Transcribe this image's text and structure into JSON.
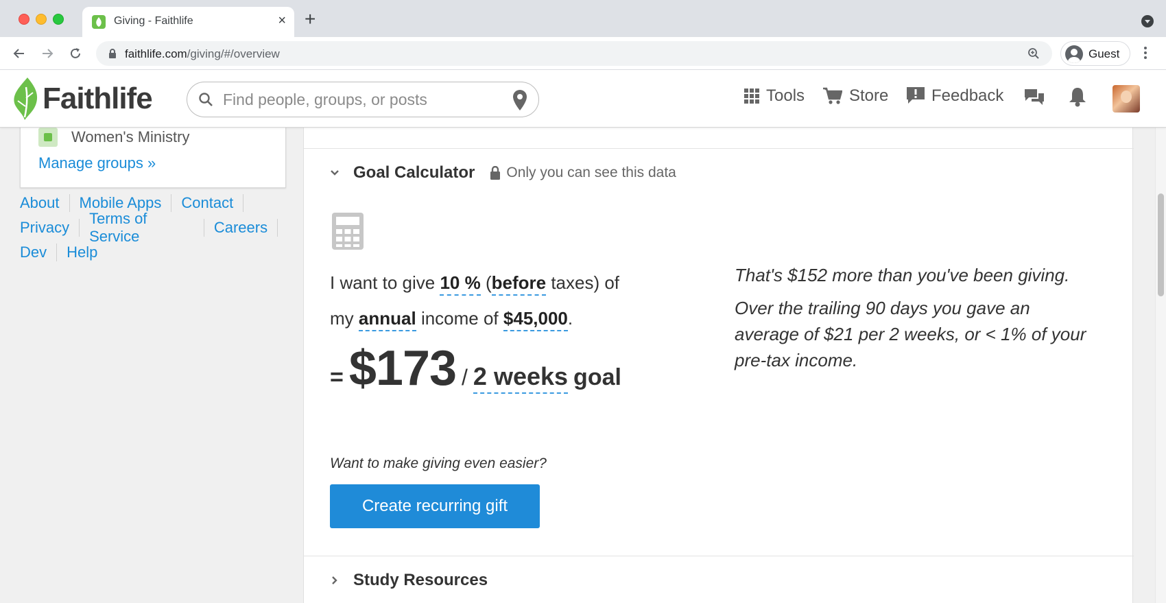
{
  "browser": {
    "tab_title": "Giving - Faithlife",
    "url_domain": "faithlife.com",
    "url_path": "/giving/#/overview",
    "profile_name": "Guest"
  },
  "header": {
    "logo_text": "Faithlife",
    "search_placeholder": "Find people, groups, or posts",
    "nav": {
      "tools": "Tools",
      "store": "Store",
      "feedback": "Feedback"
    }
  },
  "sidebar": {
    "group_name": "Women's Ministry",
    "manage_groups": "Manage groups »",
    "footer_links": {
      "about": "About",
      "mobile_apps": "Mobile Apps",
      "contact": "Contact",
      "privacy": "Privacy",
      "terms": "Terms of Service",
      "careers": "Careers",
      "dev": "Dev",
      "help": "Help"
    }
  },
  "goal_calculator": {
    "title": "Goal Calculator",
    "privacy_note": "Only you can see this data",
    "sentence": {
      "prefix": "I want to give",
      "percent": "10 %",
      "open_paren": "(",
      "tax_basis": "before",
      "after_tax": "taxes) of",
      "my": "my",
      "frequency": "annual",
      "income_of": "income of",
      "income": "$45,000",
      "end": "."
    },
    "result": {
      "equals": "=",
      "amount": "$173",
      "slash": "/",
      "period": "2 weeks",
      "goal": "goal"
    },
    "easier_prompt": "Want to make giving even easier?",
    "button_label": "Create recurring gift",
    "summary_1": "That's $152 more than you've been giving.",
    "summary_2": "Over the trailing 90 days you gave an average of $21 per 2 weeks, or < 1% of your pre-tax income."
  },
  "study_resources": {
    "title": "Study Resources"
  },
  "colors": {
    "link": "#1a8cd8",
    "button": "#1f8bd8",
    "brand_green": "#6cc04a",
    "dashed_underline": "#3a9ae0"
  }
}
